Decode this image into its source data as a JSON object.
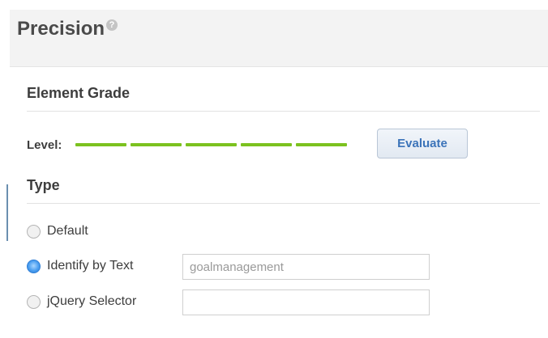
{
  "panel": {
    "title": "Precision",
    "help_icon": "?"
  },
  "element_grade": {
    "heading": "Element Grade",
    "level_label": "Level:",
    "level_value": 5,
    "level_max": 5,
    "level_color": "#7cc21f",
    "evaluate_label": "Evaluate"
  },
  "type": {
    "heading": "Type",
    "options": [
      {
        "label": "Default",
        "checked": false
      },
      {
        "label": "Identify by Text",
        "checked": true,
        "input_value": "goalmanagement"
      },
      {
        "label": "jQuery Selector",
        "checked": false,
        "input_value": ""
      }
    ]
  },
  "colors": {
    "accent": "#3b73b9",
    "radio_selected": "#4a9ef0"
  }
}
